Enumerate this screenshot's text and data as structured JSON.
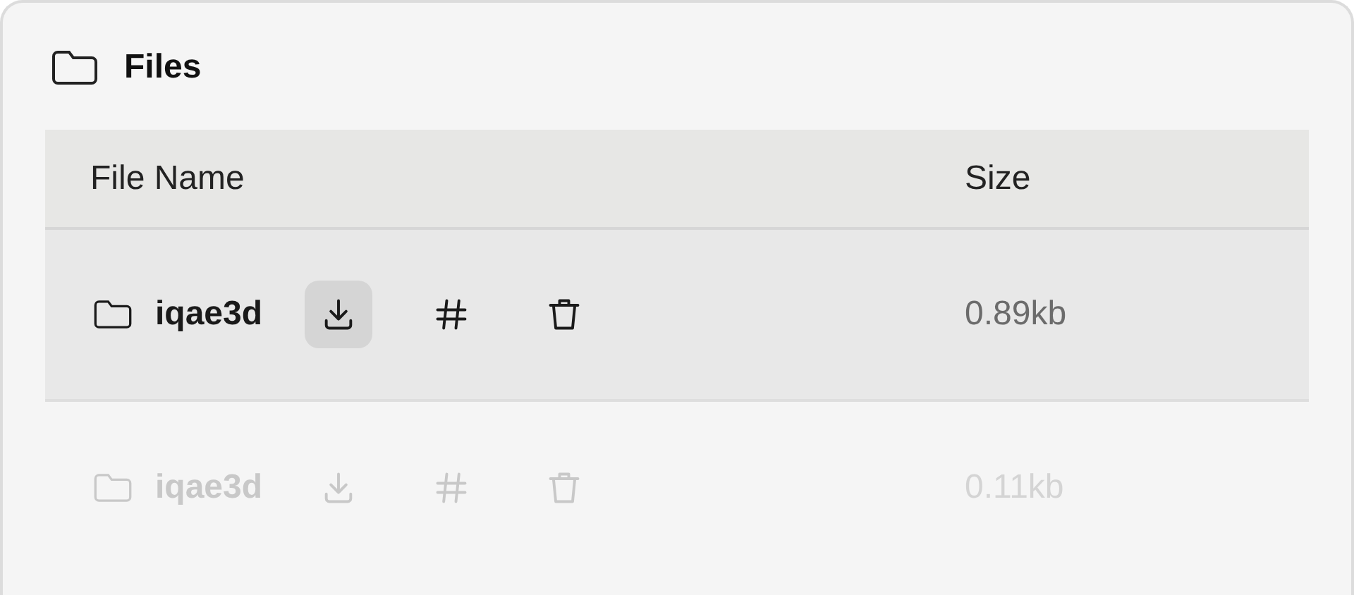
{
  "panel": {
    "title": "Files"
  },
  "table": {
    "columns": [
      "File Name",
      "Size"
    ],
    "rows": [
      {
        "name": "iqae3d",
        "size": "0.89kb",
        "selected": true,
        "disabled": false,
        "actions": [
          {
            "kind": "download",
            "highlighted": true
          },
          {
            "kind": "hash",
            "highlighted": false
          },
          {
            "kind": "delete",
            "highlighted": false
          }
        ]
      },
      {
        "name": "iqae3d",
        "size": "0.11kb",
        "selected": false,
        "disabled": true,
        "actions": [
          {
            "kind": "download",
            "highlighted": false
          },
          {
            "kind": "hash",
            "highlighted": false
          },
          {
            "kind": "delete",
            "highlighted": false
          }
        ]
      }
    ]
  }
}
